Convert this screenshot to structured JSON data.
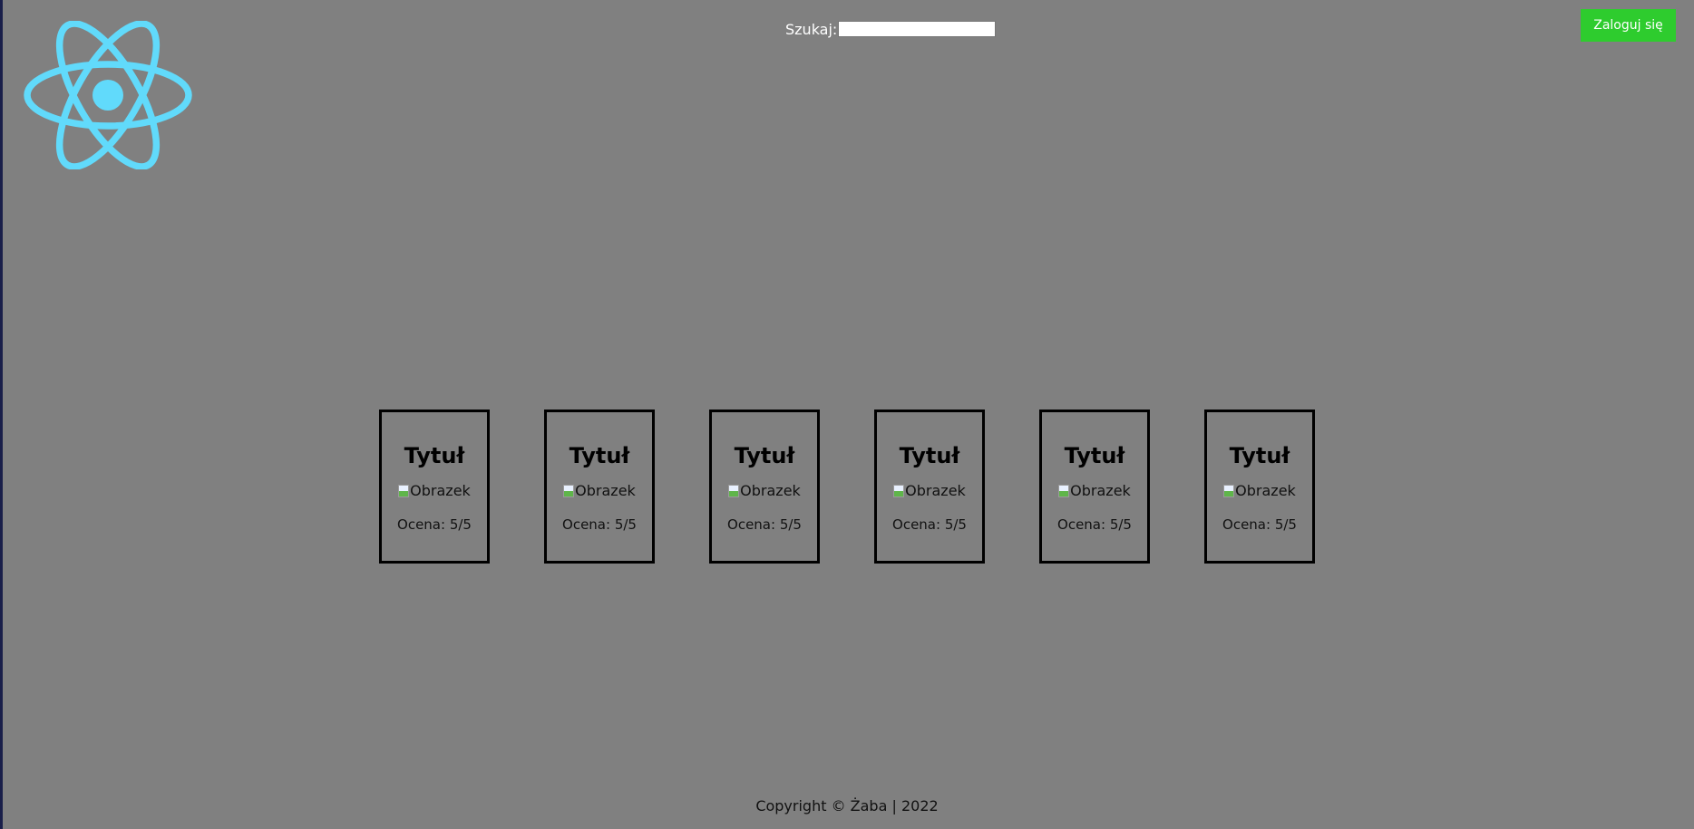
{
  "header": {
    "search_label": "Szukaj:",
    "search_value": "",
    "login_label": "Zaloguj się"
  },
  "logo": {
    "icon": "react-logo-icon",
    "color": "#61dafb"
  },
  "cards": [
    {
      "title": "Tytuł",
      "image_alt": "Obrazek",
      "rating": "Ocena: 5/5"
    },
    {
      "title": "Tytuł",
      "image_alt": "Obrazek",
      "rating": "Ocena: 5/5"
    },
    {
      "title": "Tytuł",
      "image_alt": "Obrazek",
      "rating": "Ocena: 5/5"
    },
    {
      "title": "Tytuł",
      "image_alt": "Obrazek",
      "rating": "Ocena: 5/5"
    },
    {
      "title": "Tytuł",
      "image_alt": "Obrazek",
      "rating": "Ocena: 5/5"
    },
    {
      "title": "Tytuł",
      "image_alt": "Obrazek",
      "rating": "Ocena: 5/5"
    }
  ],
  "footer": {
    "text": "Copyright © Żaba | 2022"
  },
  "colors": {
    "background": "#808080",
    "accent_button": "#2ecc2e",
    "logo": "#61dafb"
  }
}
